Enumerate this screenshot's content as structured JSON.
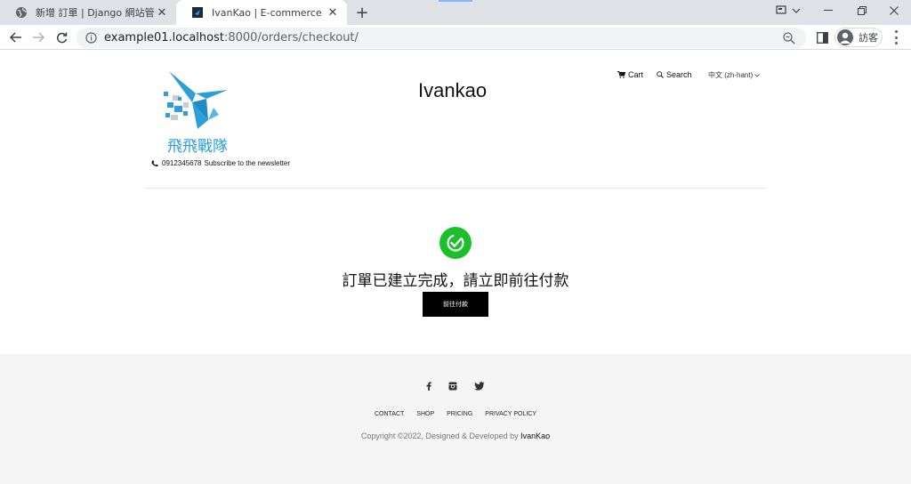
{
  "browser": {
    "tabs": [
      {
        "title": "新增 訂單 | Django 網站管理",
        "active": false
      },
      {
        "title": "IvanKao | E-commerce",
        "active": true
      }
    ],
    "url_host": "example01.localhost",
    "url_rest": ":8000/orders/checkout/",
    "profile_label": "訪客"
  },
  "header": {
    "logo_text": "飛飛戰隊",
    "phone": "0912345678",
    "newsletter": "Subscribe to the newsletter",
    "brand": "Ivankao",
    "nav": {
      "cart": "Cart",
      "search": "Search",
      "language": "中文 (zh-hant)"
    }
  },
  "main": {
    "message": "訂單已建立完成，請立即前往付款",
    "pay_button": "前往付款"
  },
  "footer": {
    "social": [
      "facebook-icon",
      "instagram-icon",
      "twitter-icon"
    ],
    "links": [
      "CONTACT",
      "SHOP",
      "PRICING",
      "PRIVACY POLICY"
    ],
    "copyright_prefix": "Copyright ©2022, Designed & Developed by ",
    "copyright_owner": "IvanKao"
  },
  "colors": {
    "success": "#1bbf2a",
    "logo_blue": "#2a9fd8",
    "tabstrip": "#dee1e6",
    "footer_bg": "#f5f5f5"
  }
}
